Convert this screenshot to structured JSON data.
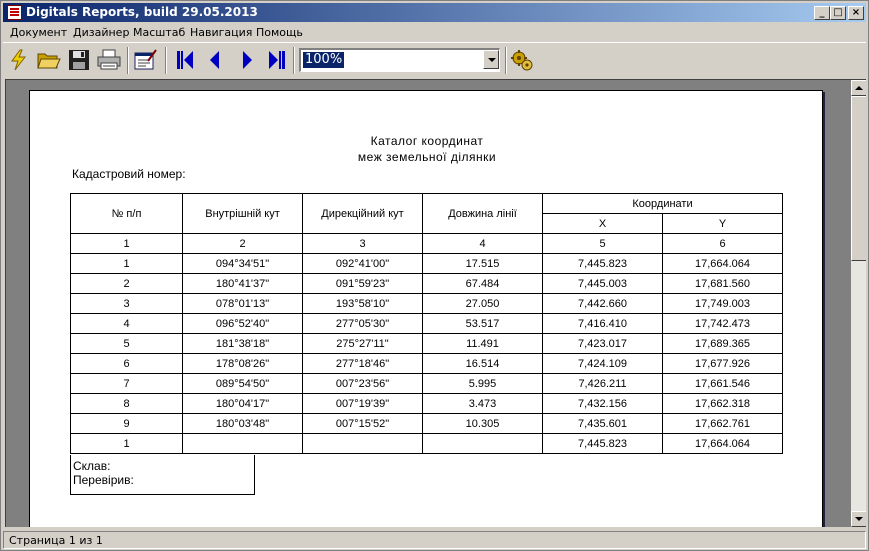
{
  "window": {
    "title": "Digitals Reports, build 29.05.2013",
    "minimize": "_",
    "maximize": "□",
    "close": "×"
  },
  "menu": [
    "Документ",
    "Дизайнер",
    "Масштаб",
    "Навигация",
    "Помощь"
  ],
  "toolbar": {
    "zoom_value": "100%"
  },
  "report": {
    "title_line1": "Каталог координат",
    "title_line2": "меж земельної ділянки",
    "cadastral_label": "Кадастровий номер:",
    "headers": {
      "num": "№ п/п",
      "inner_angle": "Внутрішній кут",
      "direction_angle": "Дирекційний кут",
      "length": "Довжина лінії",
      "coords": "Координати",
      "x": "X",
      "y": "Y"
    },
    "col_numbers": [
      "1",
      "2",
      "3",
      "4",
      "5",
      "6"
    ],
    "rows": [
      [
        "1",
        "094°34'51\"",
        "092°41'00\"",
        "17.515",
        "7,445.823",
        "17,664.064"
      ],
      [
        "2",
        "180°41'37\"",
        "091°59'23\"",
        "67.484",
        "7,445.003",
        "17,681.560"
      ],
      [
        "3",
        "078°01'13\"",
        "193°58'10\"",
        "27.050",
        "7,442.660",
        "17,749.003"
      ],
      [
        "4",
        "096°52'40\"",
        "277°05'30\"",
        "53.517",
        "7,416.410",
        "17,742.473"
      ],
      [
        "5",
        "181°38'18\"",
        "275°27'11\"",
        "11.491",
        "7,423.017",
        "17,689.365"
      ],
      [
        "6",
        "178°08'26\"",
        "277°18'46\"",
        "16.514",
        "7,424.109",
        "17,677.926"
      ],
      [
        "7",
        "089°54'50\"",
        "007°23'56\"",
        "5.995",
        "7,426.211",
        "17,661.546"
      ],
      [
        "8",
        "180°04'17\"",
        "007°19'39\"",
        "3.473",
        "7,432.156",
        "17,662.318"
      ],
      [
        "9",
        "180°03'48\"",
        "007°15'52\"",
        "10.305",
        "7,435.601",
        "17,662.761"
      ],
      [
        "1",
        "",
        "",
        "",
        "7,445.823",
        "17,664.064"
      ]
    ],
    "composed_label": "Склав:",
    "checked_label": "Перевірив:"
  },
  "status": {
    "page_text": "Страница 1 из 1"
  },
  "icons": [
    "lightning-icon",
    "open-folder-icon",
    "save-disk-icon",
    "print-icon",
    "edit-report-icon",
    "first-page-icon",
    "prev-page-icon",
    "next-page-icon",
    "last-page-icon",
    "settings-gears-icon"
  ],
  "colors": {
    "titlebar_start": "#0a246a",
    "titlebar_end": "#a6caf0",
    "nav_arrows": "#0000c0",
    "chrome": "#d4d0c8"
  }
}
